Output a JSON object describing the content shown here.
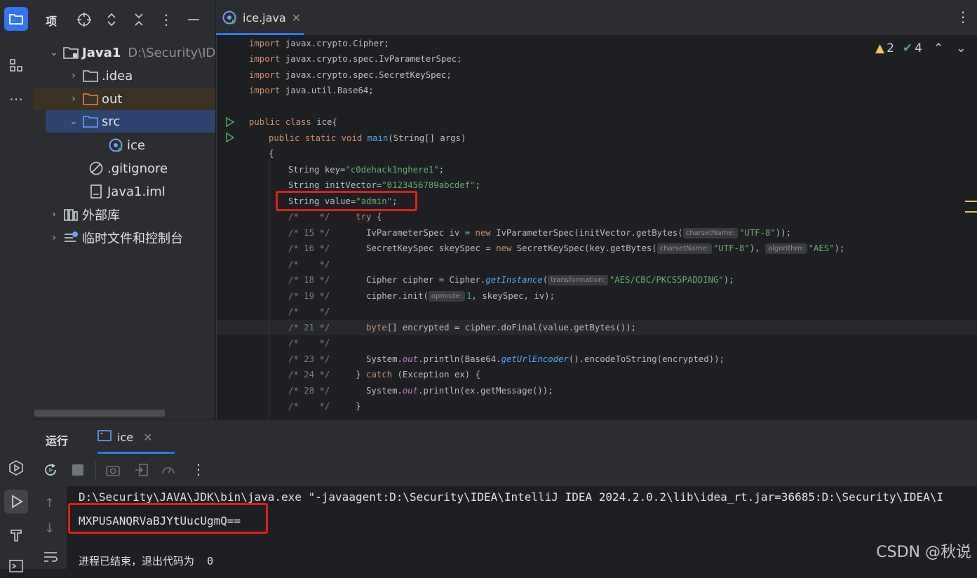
{
  "project_panel": {
    "title": "项",
    "tree": [
      {
        "label": "Java1",
        "path": "D:\\Security\\IDE",
        "icon": "module-folder-icon"
      },
      {
        "label": ".idea",
        "icon": "folder-icon"
      },
      {
        "label": "out",
        "icon": "folder-icon"
      },
      {
        "label": "src",
        "icon": "source-folder-icon"
      },
      {
        "label": "ice",
        "icon": "java-class-icon"
      },
      {
        "label": ".gitignore",
        "icon": "ignore-file-icon"
      },
      {
        "label": "Java1.iml",
        "icon": "iml-file-icon"
      },
      {
        "label": "外部库",
        "icon": "library-icon"
      },
      {
        "label": "临时文件和控制台",
        "icon": "scratch-icon"
      }
    ]
  },
  "editor": {
    "tab_label": "ice.java",
    "inspections": {
      "warnings": "2",
      "ok": "4"
    },
    "lines": {
      "l1a": "import",
      "l1b": " javax.crypto.Cipher;",
      "l2a": "import",
      "l2b": " javax.crypto.spec.IvParameterSpec;",
      "l3a": "import",
      "l3b": " javax.crypto.spec.SecretKeySpec;",
      "l4a": "import",
      "l4b": " java.util.Base64;",
      "l6a": "public class",
      "l6b": " ice{",
      "l7a": "public static void",
      "l7b": "main",
      "l7c": "(String[] args)",
      "l8": "{",
      "l9a": "String key=",
      "l9b": "\"c0dehack1nghere1\"",
      "l9c": ";",
      "l10a": "String initVector=",
      "l10b": "\"0123456789abcdef\"",
      "l10c": ";",
      "l11a": "String value=",
      "l11b": "\"admin\"",
      "l11c": ";",
      "l12a": "/*    */",
      "l12b": "try",
      "l12c": " {",
      "l13a": "/* 15 */",
      "l13b": "IvParameterSpec iv = ",
      "l13c": "new",
      "l13d": " IvParameterSpec(initVector.getBytes(",
      "l13h": "charsetName:",
      "l13e": "\"UTF-8\"",
      "l13f": "));",
      "l14a": "/* 16 */",
      "l14b": "SecretKeySpec skeySpec = ",
      "l14c": "new",
      "l14d": " SecretKeySpec(key.getBytes(",
      "l14h": "charsetName:",
      "l14e": "\"UTF-8\"",
      "l14f": "), ",
      "l14h2": "algorithm:",
      "l14g": "\"AES\"",
      "l14i": ");",
      "l15a": "/*    */",
      "l16a": "/* 18 */",
      "l16b": "Cipher cipher = Cipher.",
      "l16c": "getInstance",
      "l16d": "(",
      "l16h": "transformation:",
      "l16e": "\"AES/CBC/PKCS5PADDING\"",
      "l16f": ");",
      "l17a": "/* 19 */",
      "l17b": "cipher.init(",
      "l17h": "opmode:",
      "l17c": "1",
      "l17d": ", skeySpec, iv);",
      "l18a": "/*    */",
      "l19a": "/* 21 */",
      "l19b": "byte",
      "l19c": "[] encrypted = cipher.doFinal(value.getBytes());",
      "l20a": "/*    */",
      "l21a": "/* 23 */",
      "l21b": "System.",
      "l21c": "out",
      "l21d": ".println(Base64.",
      "l21e": "getUrlEncoder",
      "l21f": "().encodeToString(encrypted));",
      "l22a": "/* 24 */",
      "l22b": "} ",
      "l22c": "catch",
      "l22d": " (Exception ex) {",
      "l23a": "/* 28 */",
      "l23b": "System.",
      "l23c": "out",
      "l23d": ".println(ex.getMessage());",
      "l24a": "/*    */",
      "l24b": "}"
    }
  },
  "run_panel": {
    "title": "运行",
    "tab_label": "ice",
    "console": {
      "command": "D:\\Security\\JAVA\\JDK\\bin\\java.exe \"-javaagent:D:\\Security\\IDEA\\IntelliJ IDEA 2024.2.0.2\\lib\\idea_rt.jar=36685:D:\\Security\\IDEA\\I",
      "output": "MXPUSANQRVaBJYtUucUgmQ==",
      "exit": "进程已结束，退出代码为  0"
    }
  },
  "watermark": "CSDN @秋说",
  "colors": {
    "accent": "#3574f0",
    "highlight_box": "#e0201b",
    "string": "#6aab73",
    "keyword": "#cf8e6d"
  }
}
